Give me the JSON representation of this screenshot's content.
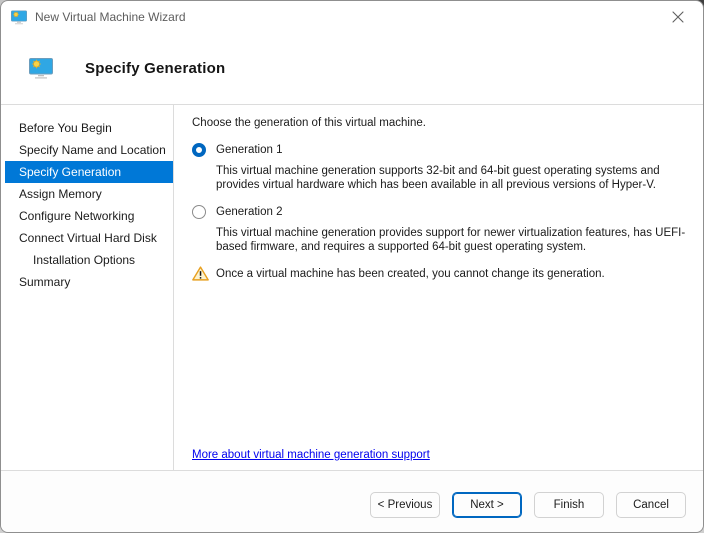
{
  "window": {
    "title": "New Virtual Machine Wizard"
  },
  "header": {
    "title": "Specify Generation"
  },
  "sidebar": {
    "items": [
      {
        "label": "Before You Begin",
        "active": false,
        "indent": false
      },
      {
        "label": "Specify Name and Location",
        "active": false,
        "indent": false
      },
      {
        "label": "Specify Generation",
        "active": true,
        "indent": false
      },
      {
        "label": "Assign Memory",
        "active": false,
        "indent": false
      },
      {
        "label": "Configure Networking",
        "active": false,
        "indent": false
      },
      {
        "label": "Connect Virtual Hard Disk",
        "active": false,
        "indent": false
      },
      {
        "label": "Installation Options",
        "active": false,
        "indent": true
      },
      {
        "label": "Summary",
        "active": false,
        "indent": false
      }
    ]
  },
  "content": {
    "intro": "Choose the generation of this virtual machine.",
    "options": [
      {
        "label": "Generation 1",
        "selected": true,
        "description": "This virtual machine generation supports 32-bit and 64-bit guest operating systems and provides virtual hardware which has been available in all previous versions of Hyper-V."
      },
      {
        "label": "Generation 2",
        "selected": false,
        "description": "This virtual machine generation provides support for newer virtualization features, has UEFI-based firmware, and requires a supported 64-bit guest operating system."
      }
    ],
    "warning": "Once a virtual machine has been created, you cannot change its generation.",
    "link": "More about virtual machine generation support"
  },
  "footer": {
    "buttons": [
      {
        "label": "< Previous",
        "default": false
      },
      {
        "label": "Next >",
        "default": true
      },
      {
        "label": "Finish",
        "default": false
      },
      {
        "label": "Cancel",
        "default": false
      }
    ]
  },
  "colors": {
    "accent": "#0078d7",
    "radio_selected": "#0067c0",
    "link": "#0000ee",
    "warning_border": "#e8a020",
    "warning_fill": "#fdf3cf"
  }
}
